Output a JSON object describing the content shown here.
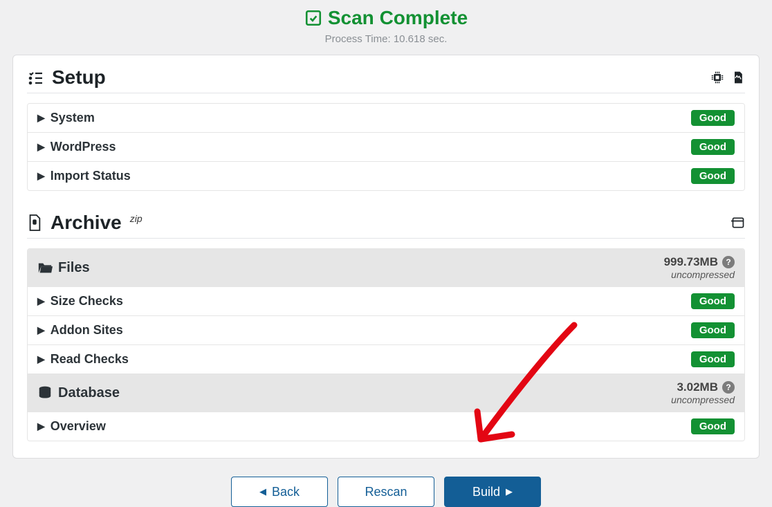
{
  "header": {
    "scan_complete": "Scan Complete",
    "process_time": "Process Time: 10.618 sec."
  },
  "setup": {
    "title": "Setup",
    "rows": {
      "system": {
        "label": "System",
        "status": "Good"
      },
      "wordpress": {
        "label": "WordPress",
        "status": "Good"
      },
      "import": {
        "label": "Import Status",
        "status": "Good"
      }
    }
  },
  "archive": {
    "title": "Archive",
    "format": "zip",
    "files": {
      "label": "Files",
      "size": "999.73MB",
      "note": "uncompressed",
      "rows": {
        "size_checks": {
          "label": "Size Checks",
          "status": "Good"
        },
        "addon_sites": {
          "label": "Addon Sites",
          "status": "Good"
        },
        "read_checks": {
          "label": "Read Checks",
          "status": "Good"
        }
      }
    },
    "database": {
      "label": "Database",
      "size": "3.02MB",
      "note": "uncompressed",
      "rows": {
        "overview": {
          "label": "Overview",
          "status": "Good"
        }
      }
    }
  },
  "buttons": {
    "back": "Back",
    "rescan": "Rescan",
    "build": "Build"
  }
}
